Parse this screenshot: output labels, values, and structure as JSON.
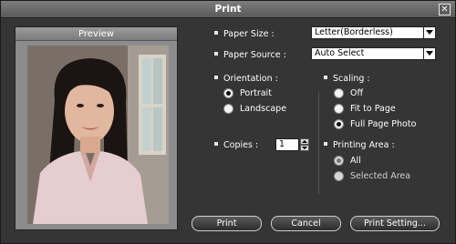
{
  "window": {
    "title": "Print"
  },
  "preview": {
    "header": "Preview"
  },
  "paper_size": {
    "label": "Paper Size :",
    "value": "Letter(Borderless)"
  },
  "paper_source": {
    "label": "Paper Source :",
    "value": "Auto Select"
  },
  "orientation": {
    "label": "Orientation :",
    "options": [
      {
        "label": "Portrait",
        "selected": true
      },
      {
        "label": "Landscape",
        "selected": false
      }
    ]
  },
  "scaling": {
    "label": "Scaling :",
    "options": [
      {
        "label": "Off",
        "selected": false
      },
      {
        "label": "Fit to Page",
        "selected": false
      },
      {
        "label": "Full Page Photo",
        "selected": true
      }
    ]
  },
  "copies": {
    "label": "Copies :",
    "value": "1"
  },
  "printing_area": {
    "label": "Printing Area :",
    "options": [
      {
        "label": "All",
        "selected": true
      },
      {
        "label": "Selected Area",
        "selected": false
      }
    ]
  },
  "buttons": {
    "print": "Print",
    "cancel": "Cancel",
    "print_setting": "Print Setting..."
  },
  "colors": {
    "dialog_bg": "#353535",
    "titlebar": "#6b6b6b",
    "text": "#ffffff"
  }
}
